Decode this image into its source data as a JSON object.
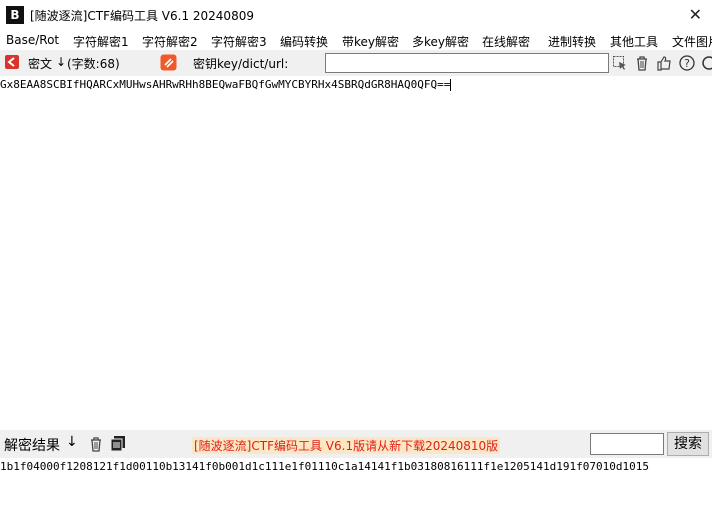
{
  "window": {
    "app_logo_text": "B",
    "title": "[随波逐流]CTF编码工具 V6.1 20240809",
    "close_glyph": "✕"
  },
  "menu": [
    "Base/Rot",
    "字符解密1",
    "字符解密2",
    "字符解密3",
    "编码转换",
    "带key解密",
    "多key解密",
    "在线解密",
    "进制转换",
    "其他工具",
    "文件图片"
  ],
  "input_toolbar": {
    "cipher_label": "密文",
    "arrow": "↓",
    "char_count": "(字数:68)",
    "key_label": "密钥key/dict/url:",
    "key_value": ""
  },
  "ciphertext": "Gx8EAA8SCBIfHQARCxMUHwsAHRwRHh8BEQwaFBQfGwMYCBYRHx4SBRQdGR8HAQ0QFQ==",
  "output_toolbar": {
    "result_label": "解密结果",
    "arrow": "↓",
    "notice": "[随波逐流]CTF编码工具 V6.1版请从新下载20240810版",
    "search_value": "",
    "search_button": "搜索"
  },
  "result": "1b1f04000f1208121f1d00110b13141f0b001d1c111e1f01110c1a14141f1b03180816111f1e1205141d191f07010d1015",
  "colors": {
    "notice_text": "#e0201a",
    "notice_bg": "#fbe7c4",
    "toolbar_bg": "#f0f0f0",
    "icon_red": "#d9342b",
    "icon_orange": "#f05a28"
  }
}
